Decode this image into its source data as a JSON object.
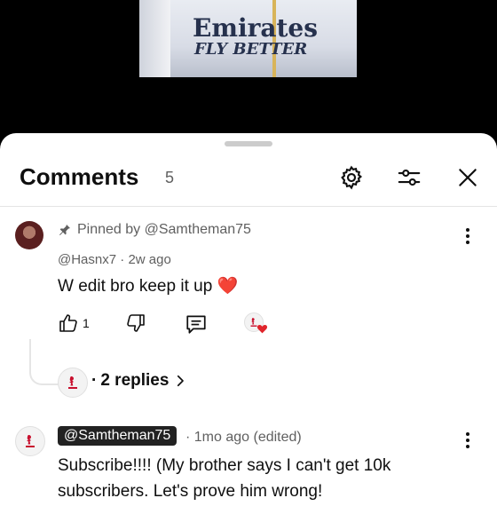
{
  "video": {
    "jersey_text_line1": "Emirates",
    "jersey_text_line2": "FLY BETTER"
  },
  "comments_panel": {
    "title": "Comments",
    "count": "5",
    "icons": [
      "settings-gear-icon",
      "filter-sliders-icon",
      "close-icon"
    ]
  },
  "comments": [
    {
      "pinned_label": "Pinned by @Samtheman75",
      "author": "@Hasnx7",
      "time": "2w ago",
      "text": "W edit bro keep it up",
      "emoji": "❤️",
      "likes": "1",
      "replies_label": "2 replies"
    },
    {
      "author": "@Samtheman75",
      "time": "1mo ago (edited)",
      "text_line1": "Subscribe!!!! (My brother says I can't get 10k",
      "text_line2": "subscribers. Let's prove him wrong!"
    }
  ],
  "separator": "·",
  "colors": {
    "text_primary": "#0f0f0f",
    "text_secondary": "#606060",
    "heart": "#e0242b",
    "lfc_red": "#c8102e"
  }
}
